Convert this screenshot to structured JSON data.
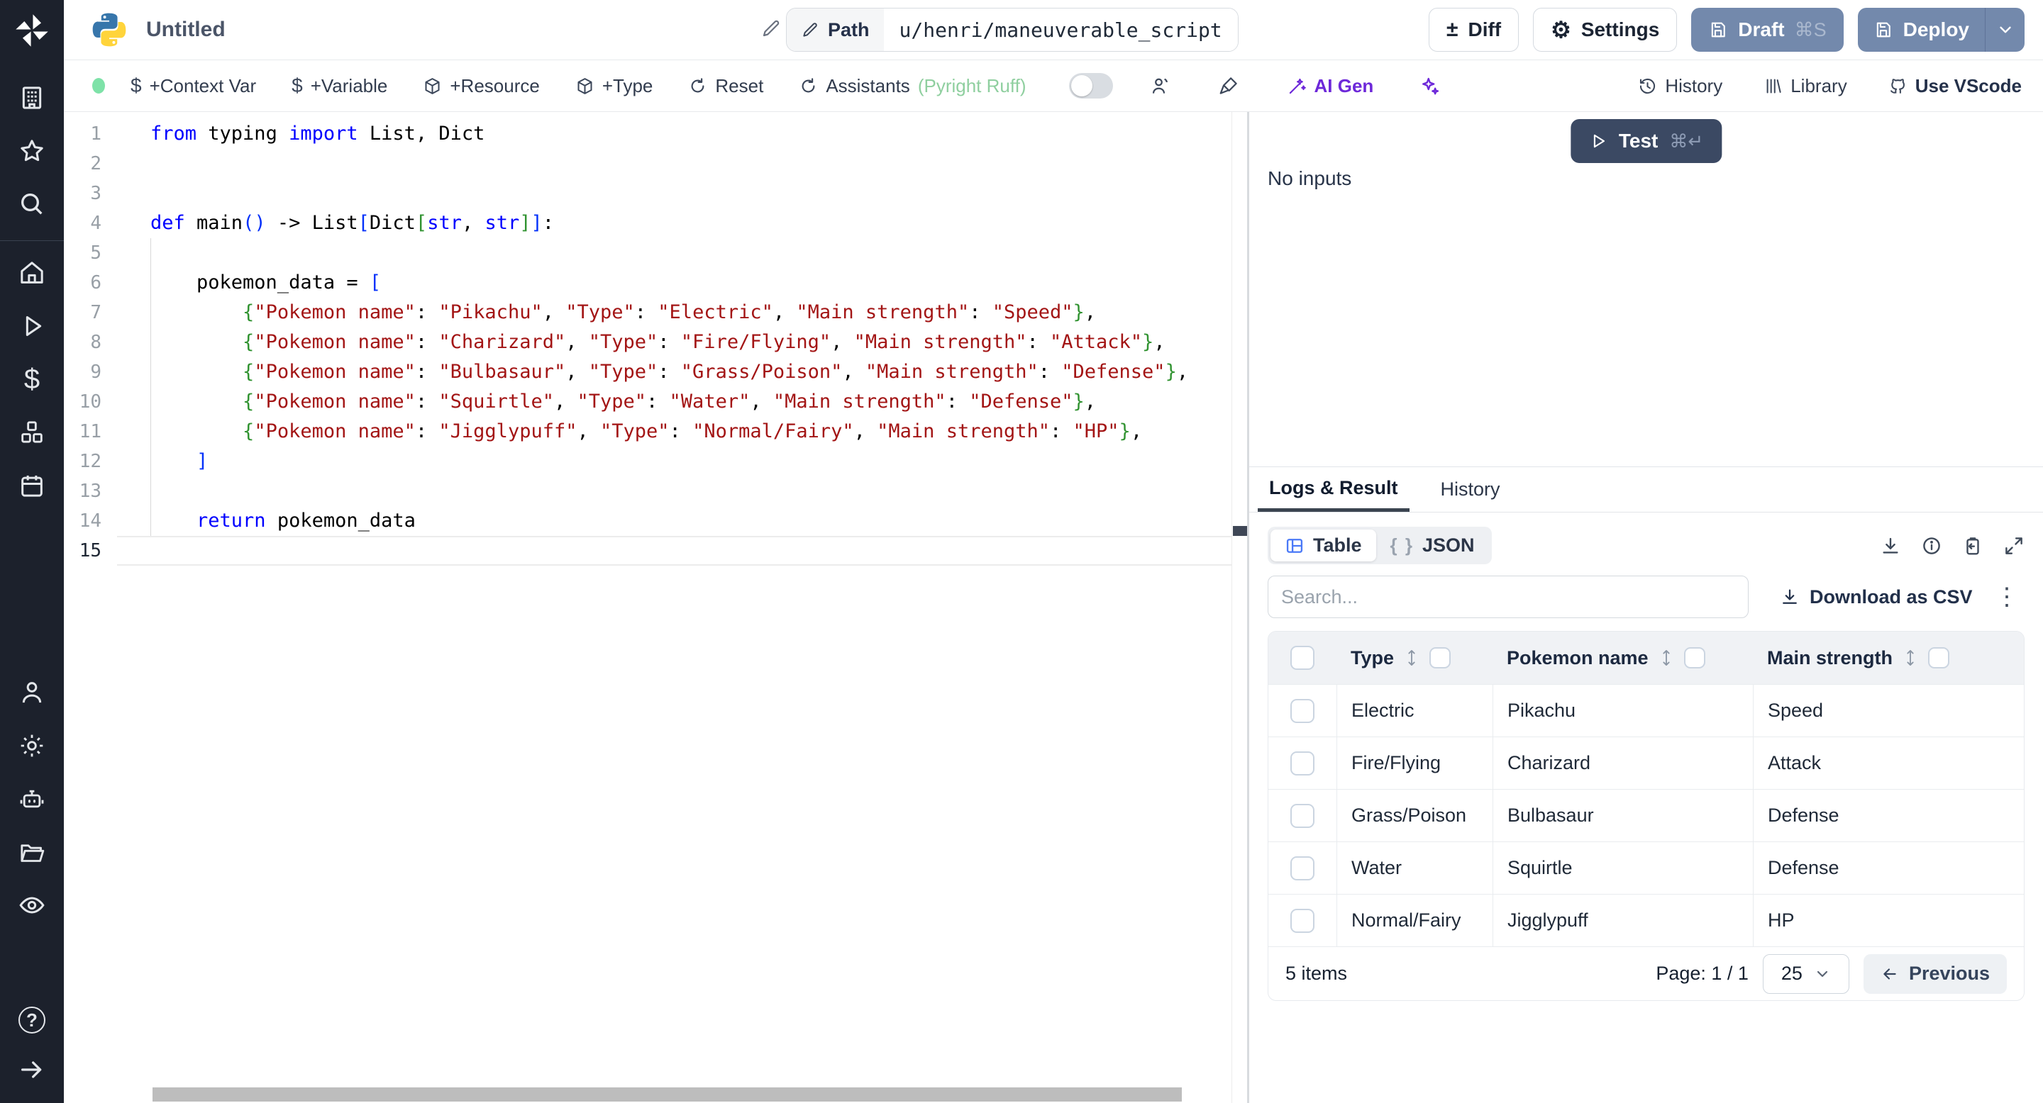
{
  "header": {
    "title": "Untitled",
    "path_label": "Path",
    "path_value": "u/henri/maneuverable_script",
    "diff_label": "Diff",
    "settings_label": "Settings",
    "draft_label": "Draft",
    "draft_shortcut": "⌘S",
    "deploy_label": "Deploy"
  },
  "toolbar": {
    "context_var": "+Context Var",
    "variable": "+Variable",
    "resource": "+Resource",
    "type": "+Type",
    "reset": "Reset",
    "assistants": "Assistants",
    "assistants_detail": "(Pyright Ruff)",
    "ai_gen": "AI Gen",
    "history": "History",
    "library": "Library",
    "use_vscode": "Use VScode"
  },
  "icons": {
    "diff": "±",
    "settings_gear": "⚙",
    "dollar": "$",
    "kebab": "⋮",
    "json_braces": "{ }",
    "help": "?"
  },
  "editor": {
    "active_line": 15,
    "lines": [
      {
        "n": 1,
        "tokens": [
          [
            "k",
            "from"
          ],
          [
            "p",
            " typing "
          ],
          [
            "k",
            "import"
          ],
          [
            "p",
            " List, Dict"
          ]
        ]
      },
      {
        "n": 2,
        "tokens": []
      },
      {
        "n": 3,
        "tokens": []
      },
      {
        "n": 4,
        "tokens": [
          [
            "k",
            "def"
          ],
          [
            "p",
            " main"
          ],
          [
            "b1",
            "()"
          ],
          [
            "p",
            " -> List"
          ],
          [
            "b1",
            "["
          ],
          [
            "p",
            "Dict"
          ],
          [
            "b2",
            "["
          ],
          [
            "k",
            "str"
          ],
          [
            "p",
            ", "
          ],
          [
            "k",
            "str"
          ],
          [
            "b2",
            "]"
          ],
          [
            "b1",
            "]"
          ],
          [
            "p",
            ":"
          ]
        ]
      },
      {
        "n": 5,
        "tokens": []
      },
      {
        "n": 6,
        "tokens": [
          [
            "p",
            "    pokemon_data = "
          ],
          [
            "b1",
            "["
          ]
        ]
      },
      {
        "n": 7,
        "tokens": [
          [
            "p",
            "        "
          ],
          [
            "b2",
            "{"
          ],
          [
            "s",
            "\"Pokemon name\""
          ],
          [
            "p",
            ": "
          ],
          [
            "s",
            "\"Pikachu\""
          ],
          [
            "p",
            ", "
          ],
          [
            "s",
            "\"Type\""
          ],
          [
            "p",
            ": "
          ],
          [
            "s",
            "\"Electric\""
          ],
          [
            "p",
            ", "
          ],
          [
            "s",
            "\"Main strength\""
          ],
          [
            "p",
            ": "
          ],
          [
            "s",
            "\"Speed\""
          ],
          [
            "b2",
            "}"
          ],
          [
            "p",
            ","
          ]
        ]
      },
      {
        "n": 8,
        "tokens": [
          [
            "p",
            "        "
          ],
          [
            "b2",
            "{"
          ],
          [
            "s",
            "\"Pokemon name\""
          ],
          [
            "p",
            ": "
          ],
          [
            "s",
            "\"Charizard\""
          ],
          [
            "p",
            ", "
          ],
          [
            "s",
            "\"Type\""
          ],
          [
            "p",
            ": "
          ],
          [
            "s",
            "\"Fire/Flying\""
          ],
          [
            "p",
            ", "
          ],
          [
            "s",
            "\"Main strength\""
          ],
          [
            "p",
            ": "
          ],
          [
            "s",
            "\"Attack\""
          ],
          [
            "b2",
            "}"
          ],
          [
            "p",
            ","
          ]
        ]
      },
      {
        "n": 9,
        "tokens": [
          [
            "p",
            "        "
          ],
          [
            "b2",
            "{"
          ],
          [
            "s",
            "\"Pokemon name\""
          ],
          [
            "p",
            ": "
          ],
          [
            "s",
            "\"Bulbasaur\""
          ],
          [
            "p",
            ", "
          ],
          [
            "s",
            "\"Type\""
          ],
          [
            "p",
            ": "
          ],
          [
            "s",
            "\"Grass/Poison\""
          ],
          [
            "p",
            ", "
          ],
          [
            "s",
            "\"Main strength\""
          ],
          [
            "p",
            ": "
          ],
          [
            "s",
            "\"Defense\""
          ],
          [
            "b2",
            "}"
          ],
          [
            "p",
            ","
          ]
        ]
      },
      {
        "n": 10,
        "tokens": [
          [
            "p",
            "        "
          ],
          [
            "b2",
            "{"
          ],
          [
            "s",
            "\"Pokemon name\""
          ],
          [
            "p",
            ": "
          ],
          [
            "s",
            "\"Squirtle\""
          ],
          [
            "p",
            ", "
          ],
          [
            "s",
            "\"Type\""
          ],
          [
            "p",
            ": "
          ],
          [
            "s",
            "\"Water\""
          ],
          [
            "p",
            ", "
          ],
          [
            "s",
            "\"Main strength\""
          ],
          [
            "p",
            ": "
          ],
          [
            "s",
            "\"Defense\""
          ],
          [
            "b2",
            "}"
          ],
          [
            "p",
            ","
          ]
        ]
      },
      {
        "n": 11,
        "tokens": [
          [
            "p",
            "        "
          ],
          [
            "b2",
            "{"
          ],
          [
            "s",
            "\"Pokemon name\""
          ],
          [
            "p",
            ": "
          ],
          [
            "s",
            "\"Jigglypuff\""
          ],
          [
            "p",
            ", "
          ],
          [
            "s",
            "\"Type\""
          ],
          [
            "p",
            ": "
          ],
          [
            "s",
            "\"Normal/Fairy\""
          ],
          [
            "p",
            ", "
          ],
          [
            "s",
            "\"Main strength\""
          ],
          [
            "p",
            ": "
          ],
          [
            "s",
            "\"HP\""
          ],
          [
            "b2",
            "}"
          ],
          [
            "p",
            ","
          ]
        ]
      },
      {
        "n": 12,
        "tokens": [
          [
            "p",
            "    "
          ],
          [
            "b1",
            "]"
          ]
        ]
      },
      {
        "n": 13,
        "tokens": []
      },
      {
        "n": 14,
        "tokens": [
          [
            "p",
            "    "
          ],
          [
            "k",
            "return"
          ],
          [
            "p",
            " pokemon_data"
          ]
        ]
      },
      {
        "n": 15,
        "tokens": []
      }
    ]
  },
  "run": {
    "test_label": "Test",
    "test_shortcut": "⌘↵",
    "no_inputs": "No inputs"
  },
  "result": {
    "tabs": [
      {
        "label": "Logs & Result",
        "active": true
      },
      {
        "label": "History",
        "active": false
      }
    ],
    "view_toggle": {
      "table": "Table",
      "json": "JSON",
      "active": "Table"
    },
    "search_placeholder": "Search...",
    "download_csv": "Download as CSV",
    "table": {
      "columns": [
        "Type",
        "Pokemon name",
        "Main strength"
      ],
      "rows": [
        [
          "Electric",
          "Pikachu",
          "Speed"
        ],
        [
          "Fire/Flying",
          "Charizard",
          "Attack"
        ],
        [
          "Grass/Poison",
          "Bulbasaur",
          "Defense"
        ],
        [
          "Water",
          "Squirtle",
          "Defense"
        ],
        [
          "Normal/Fairy",
          "Jigglypuff",
          "HP"
        ]
      ]
    },
    "footer": {
      "items_label": "5 items",
      "page_label": "Page: 1 / 1",
      "page_size": "25",
      "previous_label": "Previous"
    }
  }
}
